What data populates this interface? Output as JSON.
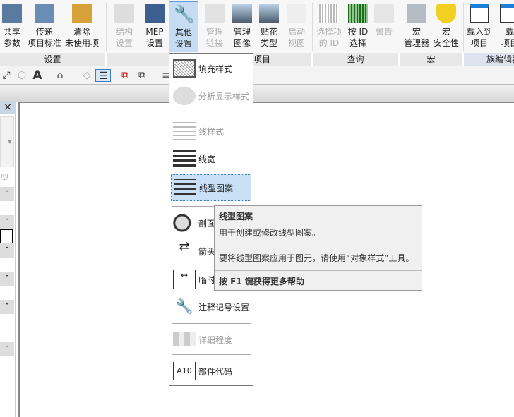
{
  "ribbon": {
    "buttons": [
      {
        "label1": "共享",
        "label2": "参数",
        "enabled": true
      },
      {
        "label1": "传递",
        "label2": "项目标准",
        "enabled": true
      },
      {
        "label1": "清除",
        "label2": "未使用项",
        "enabled": true
      },
      {
        "label1": "结构",
        "label2": "设置",
        "enabled": false
      },
      {
        "label1": "MEP",
        "label2": "设置",
        "enabled": true
      },
      {
        "label1": "其他",
        "label2": "设置",
        "enabled": true,
        "active": true
      },
      {
        "label1": "管理",
        "label2": "链接",
        "enabled": false
      },
      {
        "label1": "管理",
        "label2": "图像",
        "enabled": true
      },
      {
        "label1": "贴花",
        "label2": "类型",
        "enabled": true
      },
      {
        "label1": "启动",
        "label2": "视图",
        "enabled": false
      },
      {
        "label1": "选择项",
        "label2": "的 ID",
        "enabled": false
      },
      {
        "label1": "按 ID",
        "label2": "选择",
        "enabled": true
      },
      {
        "label1": "警告",
        "label2": "",
        "enabled": false
      },
      {
        "label1": "宏",
        "label2": "管理器",
        "enabled": true
      },
      {
        "label1": "宏",
        "label2": "安全性",
        "enabled": true
      },
      {
        "label1": "载入到",
        "label2": "项目",
        "enabled": true
      },
      {
        "label1": "载",
        "label2": "项目",
        "enabled": true
      }
    ],
    "panels": [
      "设置",
      "项目",
      "查询",
      "宏",
      "族编辑器"
    ]
  },
  "left_panel": {
    "close": "×",
    "type_label": "型"
  },
  "menu": {
    "items": [
      {
        "label": "填充样式",
        "enabled": true
      },
      {
        "label": "分析显示样式",
        "enabled": false
      },
      {
        "label": "线样式",
        "enabled": false
      },
      {
        "label": "线宽",
        "enabled": true
      },
      {
        "label": "线型图案",
        "enabled": true,
        "highlighted": true
      },
      {
        "label": "剖面",
        "enabled": true
      },
      {
        "label": "箭头",
        "enabled": true
      },
      {
        "label": "临时",
        "enabled": true
      },
      {
        "label": "注释记号设置",
        "enabled": true
      },
      {
        "label": "详细程度",
        "enabled": false
      },
      {
        "label": "部件代码",
        "enabled": true
      }
    ]
  },
  "tooltip": {
    "title": "线型图案",
    "desc": "用于创建或修改线型图案。",
    "detail": "要将线型图案应用于图元，请使用“对象样式”工具。",
    "help": "按 F1 键获得更多帮助"
  }
}
